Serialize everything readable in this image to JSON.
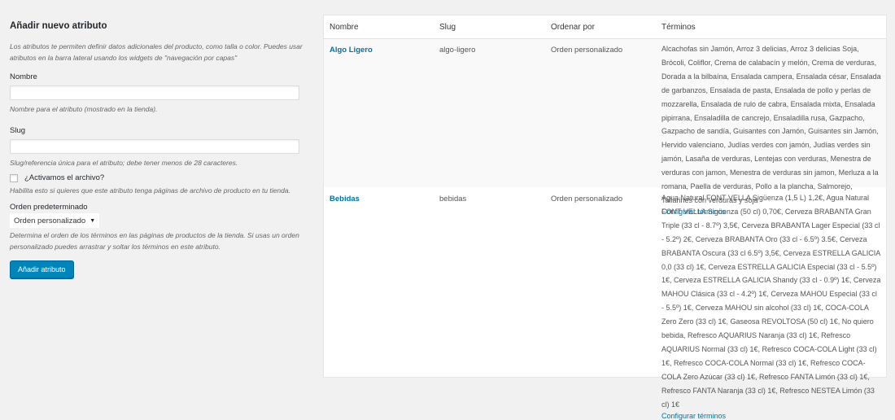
{
  "form": {
    "title": "Añadir nuevo atributo",
    "intro": "Los atributos te permiten definir datos adicionales del producto, como talla o color. Puedes usar atributos en la barra lateral usando los widgets de \"navegación por capas\"",
    "name_label": "Nombre",
    "name_value": "",
    "name_help": "Nombre para el atributo (mostrado en la tienda).",
    "slug_label": "Slug",
    "slug_value": "",
    "slug_help": "Slug/referencia única para el atributo; debe tener menos de 28 caracteres.",
    "archive_label": "¿Activamos el archivo?",
    "archive_help": "Habilita esto si quieres que este atributo tenga páginas de archivo de producto en tu tienda.",
    "order_label": "Orden predeterminado",
    "order_value": "Orden personalizado",
    "order_help": "Determina el orden de los términos en las páginas de productos de la tienda. Si usas un orden personalizado puedes arrastrar y soltar los términos en este atributo.",
    "submit_label": "Añadir atributo"
  },
  "table": {
    "headers": {
      "name": "Nombre",
      "slug": "Slug",
      "order": "Ordenar por",
      "terms": "Términos"
    },
    "rows": [
      {
        "name": "Algo Ligero",
        "slug": "algo-ligero",
        "order": "Orden personalizado",
        "terms": "Alcachofas sin Jamón, Arroz 3 delicias, Arroz 3 delicias Soja, Brócoli, Coliflor, Crema de calabacín y melón, Crema de verduras, Dorada a la bilbaína, Ensalada campera, Ensalada césar, Ensalada de garbanzos, Ensalada de pasta, Ensalada de pollo y perlas de mozzarella, Ensalada de rulo de cabra, Ensalada mixta, Ensalada pipirrana, Ensaladilla de cancrejo, Ensaladilla rusa, Gazpacho, Gazpacho de sandía, Guisantes con Jamón, Guisantes sin Jamón, Hervido valenciano, Judías verdes con jamón, Judías verdes sin jamón, Lasaña de verduras, Lentejas con verduras, Menestra de verduras con jamon, Menestra de verduras sin jamon, Merluza a la romana, Paella de verduras, Pollo a la plancha, Salmorejo, Tallarines con verduras y soja",
        "configure": "Configurar términos"
      },
      {
        "name": "Bebidas",
        "slug": "bebidas",
        "order": "Orden personalizado",
        "terms": "Agua Natural FONT VELLA Sigüenza (1,5 L) 1,2€, Agua Natural FONT VELLA Sigüenza (50 cl) 0,70€, Cerveza BRABANTA Gran Triple (33 cl - 8.7º) 3,5€, Cerveza BRABANTA Lager Especial (33 cl - 5.2º) 2€, Cerveza BRABANTA Oro (33 cl - 6.5º) 3.5€, Cerveza BRABANTA Oscura (33 cl 6.5º) 3,5€, Cerveza ESTRELLA GALICIA 0,0 (33 cl) 1€, Cerveza ESTRELLA GALICIA Especial (33 cl - 5.5º) 1€, Cerveza ESTRELLA GALICIA Shandy (33 cl - 0.9º) 1€, Cerveza MAHOU Clásica (33 cl - 4.2º) 1€, Cerveza MAHOU Especial (33 cl - 5.5º) 1€, Cerveza MAHOU sin alcohol (33 cl) 1€, COCA-COLA Zero Zero (33 cl) 1€, Gaseosa REVOLTOSA (50 cl) 1€, No quiero bebida, Refresco AQUARIUS Naranja (33 cl) 1€, Refresco AQUARIUS Normal (33 cl) 1€, Refresco COCA-COLA Light (33 cl) 1€, Refresco COCA-COLA Normal (33 cl) 1€, Refresco COCA-COLA Zero Azúcar (33 cl) 1€, Refresco FANTA Limón (33 cl) 1€, Refresco FANTA Naranja (33 cl) 1€, Refresco NESTEA Limón (33 cl) 1€",
        "configure": "Configurar términos"
      }
    ]
  },
  "colors": {
    "link": "#0073aa",
    "primary_button": "#0085ba",
    "background": "#f1f1f1"
  }
}
